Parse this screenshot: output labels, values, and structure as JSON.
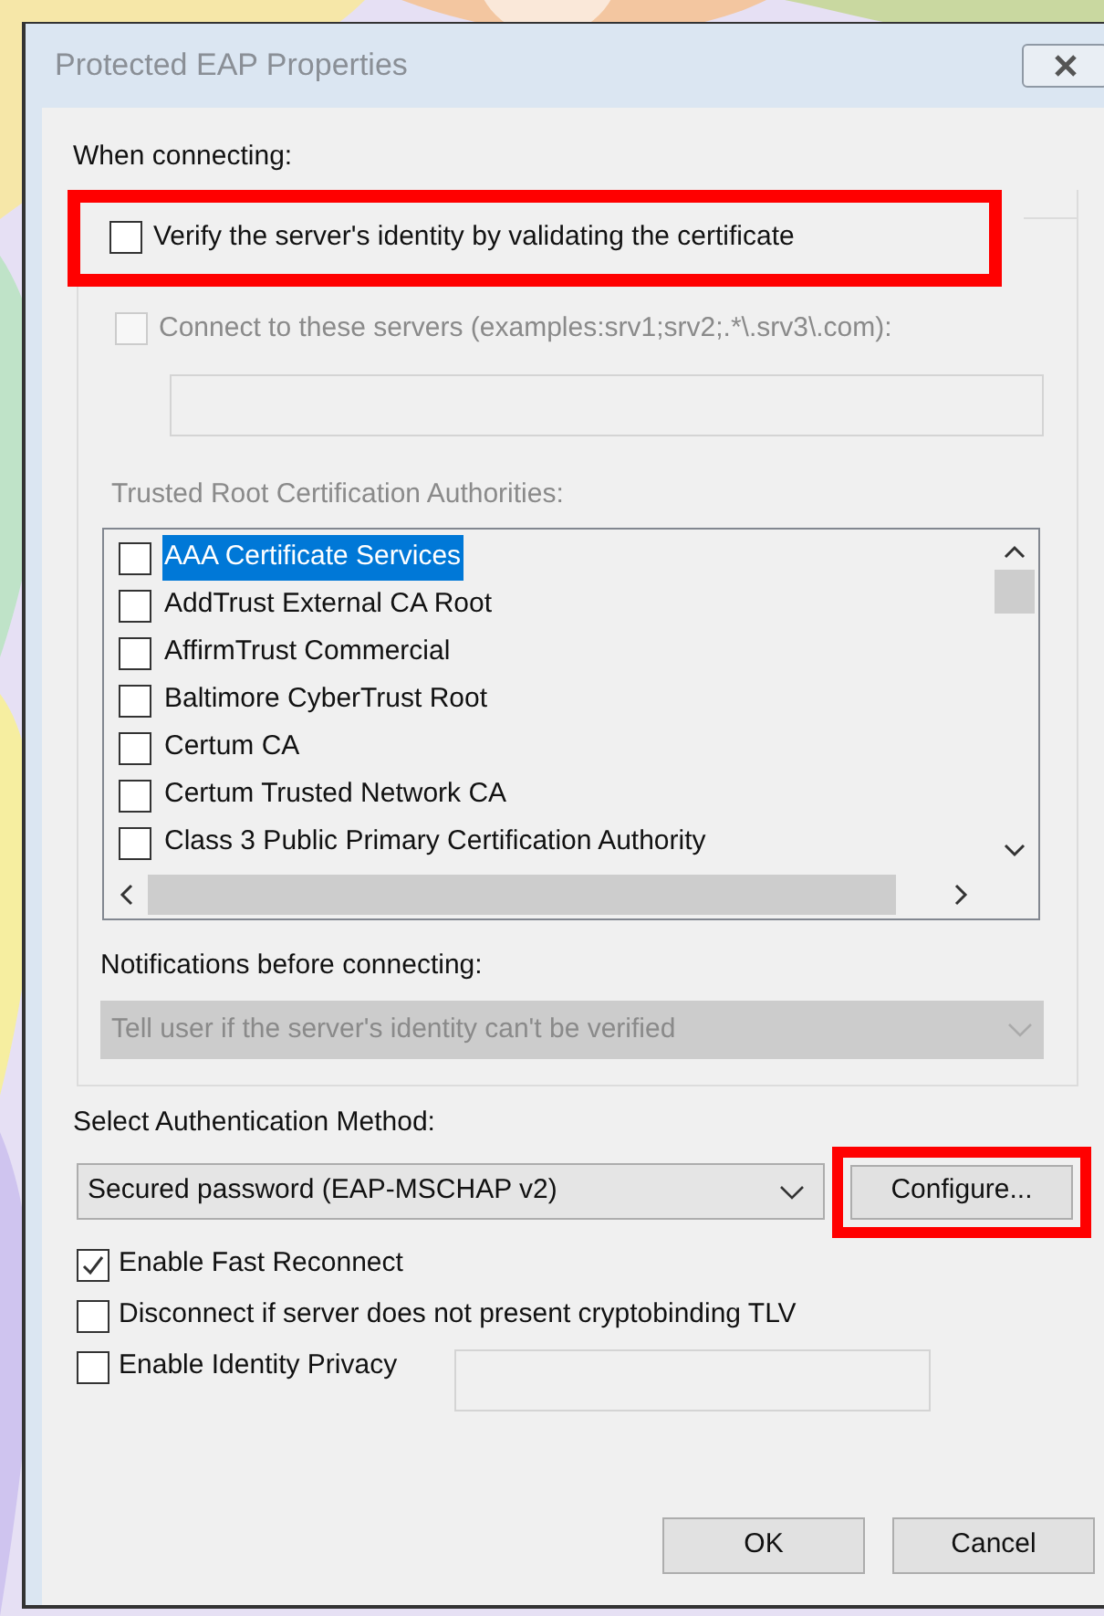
{
  "window": {
    "title": "Protected EAP Properties"
  },
  "when_connecting": {
    "label": "When connecting:"
  },
  "verify_certificate": {
    "label": "Verify the server's identity by validating the certificate",
    "checked": false,
    "highlighted": true
  },
  "connect_servers": {
    "label": "Connect to these servers (examples:srv1;srv2;.*\\.srv3\\.com):",
    "checked": false,
    "disabled": true
  },
  "trusted_root": {
    "label": "Trusted Root Certification Authorities:",
    "disabled": true,
    "items": [
      {
        "label": "AAA Certificate Services",
        "checked": false,
        "selected": true
      },
      {
        "label": "AddTrust External CA Root",
        "checked": false,
        "selected": false
      },
      {
        "label": "AffirmTrust Commercial",
        "checked": false,
        "selected": false
      },
      {
        "label": "Baltimore CyberTrust Root",
        "checked": false,
        "selected": false
      },
      {
        "label": "Certum CA",
        "checked": false,
        "selected": false
      },
      {
        "label": "Certum Trusted Network CA",
        "checked": false,
        "selected": false
      },
      {
        "label": "Class 3 Public Primary Certification Authority",
        "checked": false,
        "selected": false
      }
    ]
  },
  "notifications": {
    "label": "Notifications before connecting:",
    "value": "Tell user if the server's identity can't be verified",
    "disabled": true
  },
  "auth_method": {
    "label": "Select Authentication Method:",
    "value": "Secured password (EAP-MSCHAP v2)"
  },
  "configure_button": {
    "label": "Configure...",
    "highlighted": true
  },
  "options": [
    {
      "kind": "plain",
      "label": "Enable Fast Reconnect",
      "checked": true
    },
    {
      "kind": "plain",
      "label": "Disconnect if server does not present cryptobinding TLV",
      "checked": false
    },
    {
      "kind": "with-field",
      "label": "Enable Identity Privacy",
      "checked": false
    }
  ],
  "buttons": [
    "OK",
    "Cancel"
  ]
}
